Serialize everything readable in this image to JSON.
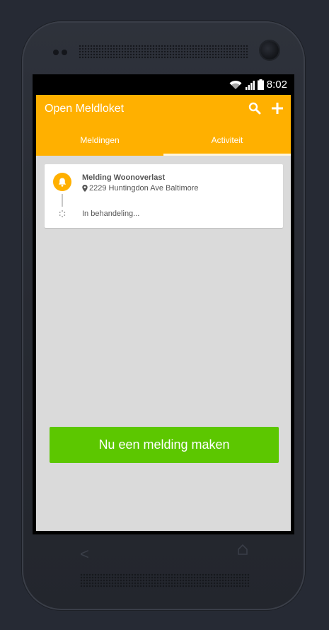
{
  "statusbar": {
    "time": "8:02"
  },
  "appbar": {
    "title": "Open Meldloket"
  },
  "tabs": [
    {
      "label": "Meldingen",
      "active": false
    },
    {
      "label": "Activiteit",
      "active": true
    }
  ],
  "card": {
    "title": "Melding Woonoverlast",
    "address": "2229 Huntingdon Ave Baltimore",
    "status": "In behandeling..."
  },
  "cta": {
    "label": "Nu een melding maken"
  },
  "colors": {
    "accent": "#ffb000",
    "cta": "#5cc700",
    "background": "#dadada"
  }
}
